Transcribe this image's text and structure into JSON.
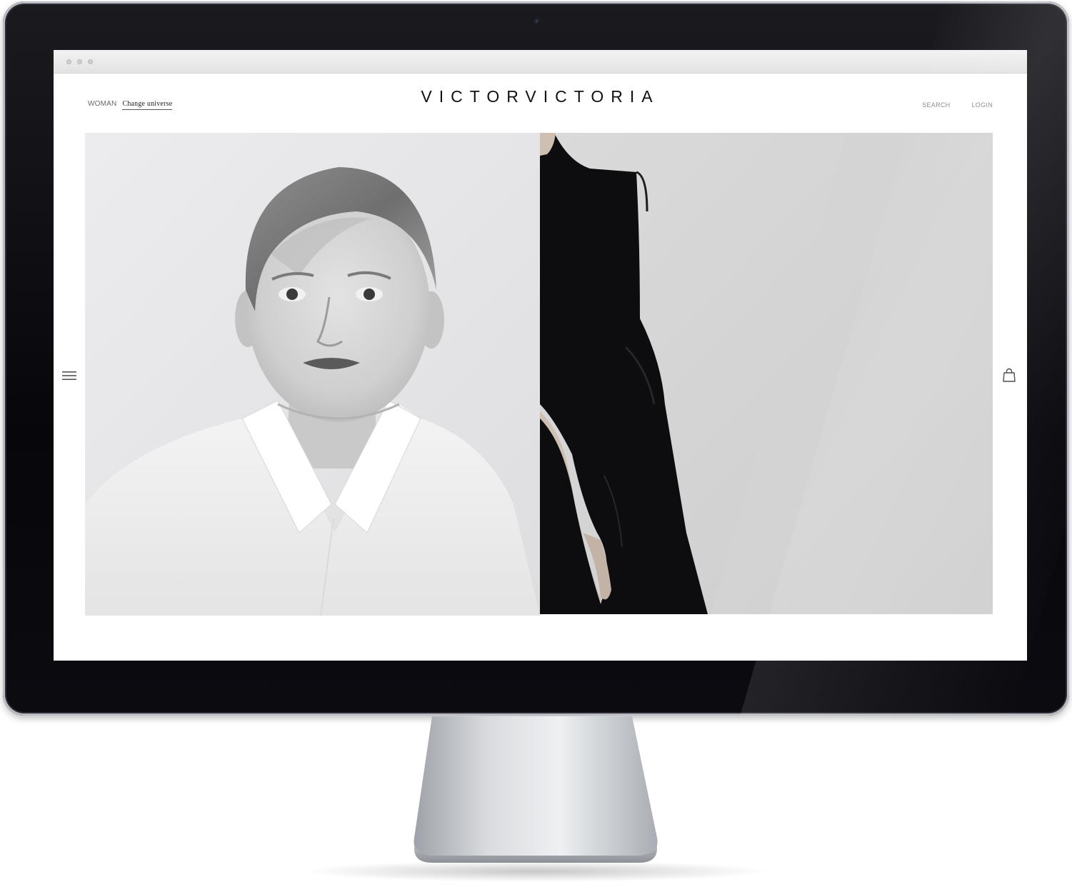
{
  "site": {
    "logo": "VICTORVICTORIA"
  },
  "header": {
    "universe_label": "WOMAN",
    "change_universe": "Change universe",
    "search": "SEARCH",
    "login": "LOGIN"
  },
  "icons": {
    "menu": "hamburger-menu-icon",
    "bag": "shopping-bag-icon"
  },
  "colors": {
    "logo_text": "#111111",
    "nav_text": "#888888",
    "bezel": "#0b0b10"
  }
}
